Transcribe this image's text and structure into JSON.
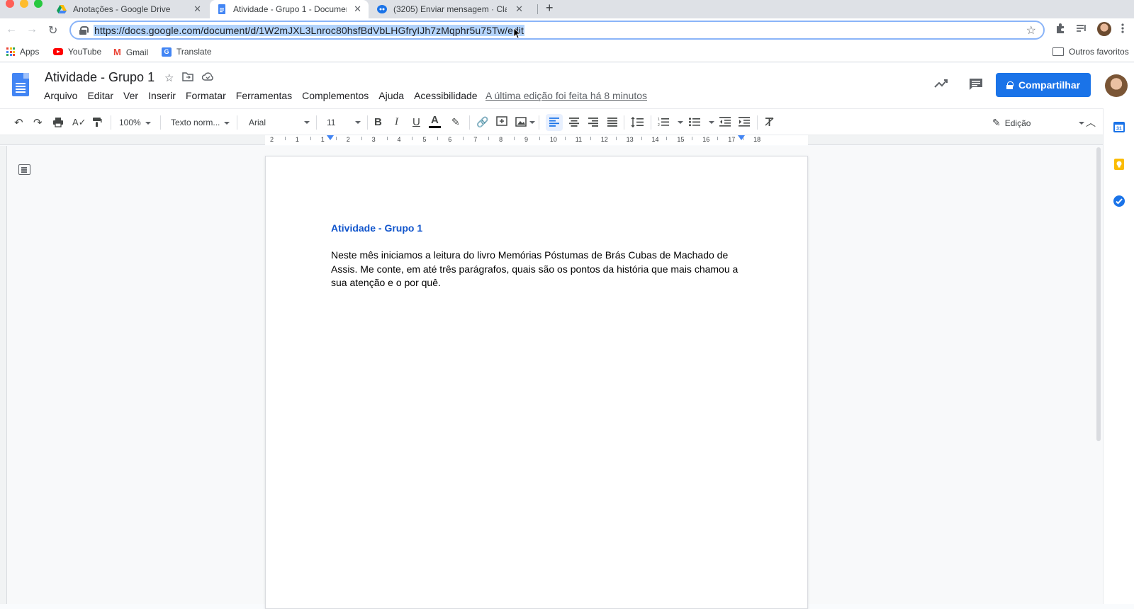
{
  "tabs": [
    {
      "title": "Anotações - Google Drive",
      "close": "✕"
    },
    {
      "title": "Atividade - Grupo 1 - Documen",
      "close": "✕"
    },
    {
      "title": "(3205) Enviar mensagem · Clar",
      "close": "✕"
    }
  ],
  "new_tab": "+",
  "nav": {
    "back": "←",
    "forward": "→",
    "reload": "↻"
  },
  "omnibox": {
    "url": "https://docs.google.com/document/d/1W2mJXL3Lnroc80hsfBdVbLHGfryIJh7zMqphr5u75Tw/edit",
    "star": "☆"
  },
  "bookmarks": {
    "apps": "Apps",
    "youtube": "YouTube",
    "gmail_logo": "M",
    "gmail": "Gmail",
    "translate_logo": "G",
    "translate": "Translate",
    "others": "Outros favoritos"
  },
  "docs": {
    "title": "Atividade - Grupo 1",
    "menus": [
      "Arquivo",
      "Editar",
      "Ver",
      "Inserir",
      "Formatar",
      "Ferramentas",
      "Complementos",
      "Ajuda",
      "Acessibilidade"
    ],
    "last_edit": "A última edição foi feita há 8 minutos",
    "share": "Compartilhar"
  },
  "format_toolbar": {
    "zoom": "100%",
    "style": "Texto norm...",
    "font": "Arial",
    "size": "11",
    "bold": "B",
    "italic": "I",
    "underline": "U",
    "text_color": "A",
    "mode": "Edição"
  },
  "ruler_ticks": [
    "2",
    "1",
    "1",
    "2",
    "3",
    "4",
    "5",
    "6",
    "7",
    "8",
    "9",
    "10",
    "11",
    "12",
    "13",
    "14",
    "15",
    "16",
    "17",
    "18"
  ],
  "document": {
    "heading": "Atividade - Grupo 1",
    "heading_color": "#1155cc",
    "body": "Neste mês iniciamos a leitura do livro Memórias Póstumas de Brás Cubas de Machado de Assis. Me conte, em até três parágrafos, quais são os pontos da história que mais chamou a sua atenção e o por quê."
  },
  "colors": {
    "accent": "#1a73e8",
    "docs_blue": "#4285f4",
    "url_highlight": "#b3d4fc"
  }
}
